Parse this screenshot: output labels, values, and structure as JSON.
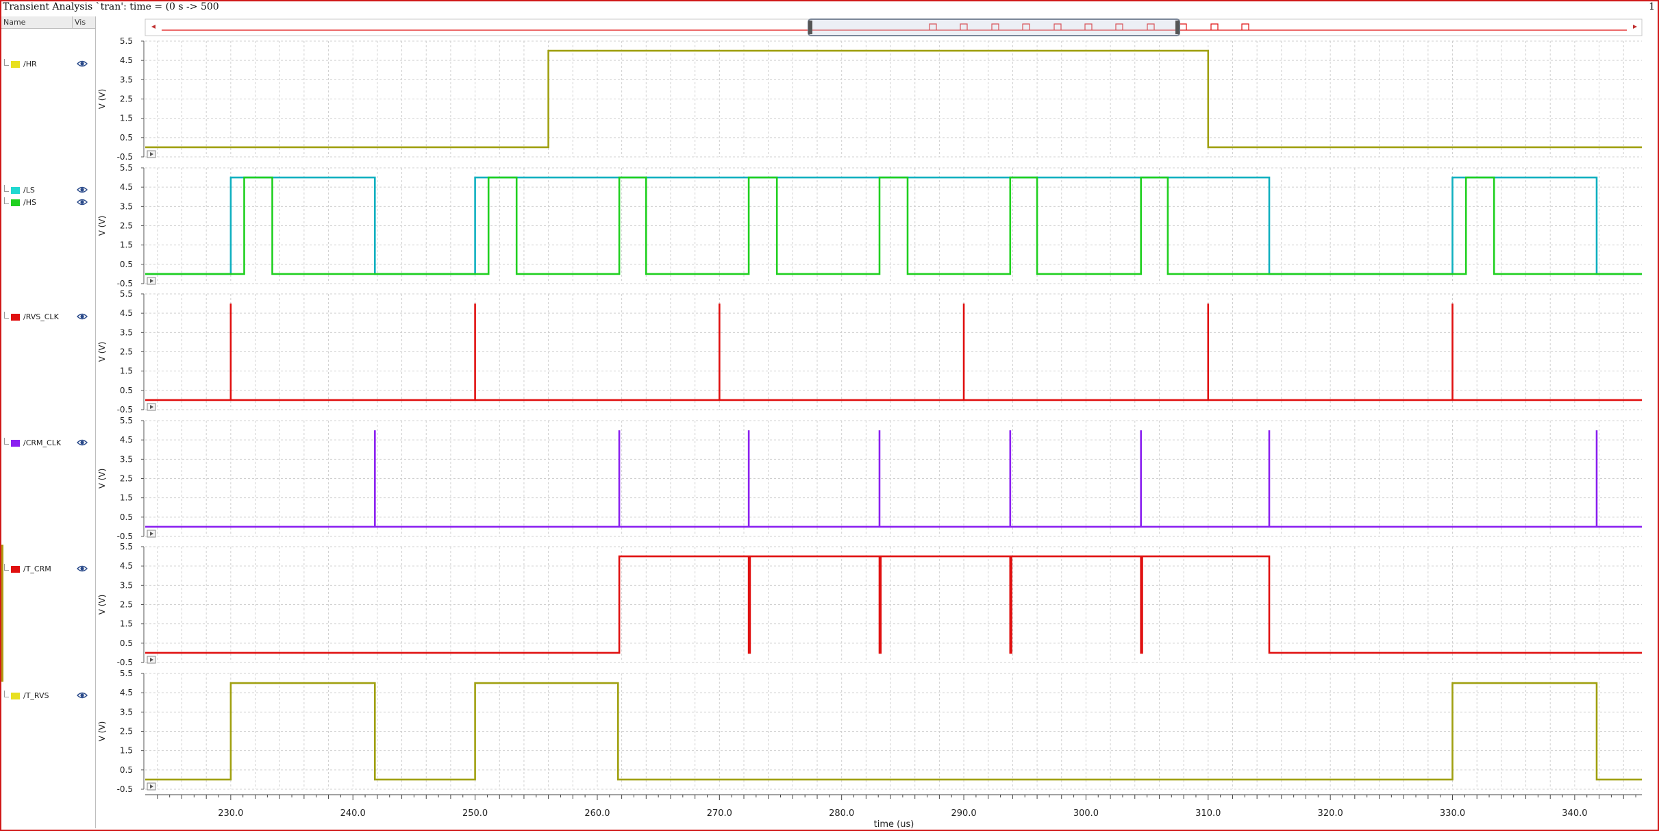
{
  "window": {
    "title": "Transient Analysis `tran': time = (0 s -> 500",
    "page_number": "1"
  },
  "sidebar": {
    "header_name": "Name",
    "header_vis": "Vis",
    "signals": [
      {
        "label": "/HR",
        "color": "#e8e020",
        "icon": "eye-icon"
      },
      {
        "label": "/LS",
        "color": "#20d8d0",
        "icon": "eye-icon"
      },
      {
        "label": "/HS",
        "color": "#20d020",
        "icon": "eye-icon"
      },
      {
        "label": "/RVS_CLK",
        "color": "#e01010",
        "icon": "eye-icon"
      },
      {
        "label": "/CRM_CLK",
        "color": "#8a20f0",
        "icon": "eye-icon"
      },
      {
        "label": "/T_CRM",
        "color": "#e01010",
        "icon": "eye-icon"
      },
      {
        "label": "/T_RVS",
        "color": "#e8e020",
        "icon": "eye-icon"
      }
    ]
  },
  "chart_data": {
    "type": "line",
    "xlabel": "time (us)",
    "xlim": [
      223.0,
      345.5
    ],
    "x_ticks": [
      "230.0",
      "240.0",
      "250.0",
      "260.0",
      "270.0",
      "280.0",
      "290.0",
      "300.0",
      "310.0",
      "320.0",
      "330.0",
      "340.0"
    ],
    "ylabel": "V (V)",
    "ylim": [
      -0.5,
      5.5
    ],
    "y_ticks": [
      "5.5",
      "4.5",
      "3.5",
      "2.5",
      "1.5",
      "0.5",
      "-0.5"
    ],
    "grid": true,
    "panels": [
      {
        "series": [
          {
            "name": "/HR",
            "color": "#a0a010",
            "low": 0.0,
            "high": 5.0,
            "x": [
              223.0,
              256.0,
              256.0,
              310.0,
              310.0,
              345.5
            ],
            "y": [
              0,
              0,
              5,
              5,
              0,
              0
            ]
          }
        ]
      },
      {
        "series": [
          {
            "name": "/LS",
            "color": "#10b0c0",
            "low": 0.0,
            "high": 5.0,
            "x": [
              223.0,
              230.0,
              230.0,
              241.8,
              241.8,
              250.0,
              250.0,
              315.0,
              315.0,
              330.0,
              330.0,
              341.8,
              341.8,
              345.5
            ],
            "y": [
              0,
              0,
              5,
              5,
              0,
              0,
              5,
              5,
              0,
              0,
              5,
              5,
              0,
              0
            ]
          },
          {
            "name": "/HS",
            "color": "#20d020",
            "low": 0.0,
            "high": 5.0,
            "x": [
              223.0,
              231.1,
              231.1,
              233.4,
              233.4,
              251.1,
              251.1,
              253.4,
              253.4,
              261.8,
              261.8,
              264.0,
              264.0,
              272.4,
              272.4,
              274.7,
              274.7,
              283.1,
              283.1,
              285.4,
              285.4,
              293.8,
              293.8,
              296.0,
              296.0,
              304.5,
              304.5,
              306.7,
              306.7,
              331.1,
              331.1,
              333.4,
              333.4,
              345.5
            ],
            "y": [
              0,
              0,
              5,
              5,
              0,
              0,
              5,
              5,
              0,
              0,
              5,
              5,
              0,
              0,
              5,
              5,
              0,
              0,
              5,
              5,
              0,
              0,
              5,
              5,
              0,
              0,
              5,
              5,
              0,
              0,
              5,
              5,
              0,
              0
            ]
          }
        ]
      },
      {
        "series": [
          {
            "name": "/RVS_CLK",
            "color": "#e01010",
            "low": 0.0,
            "high": 5.0,
            "pulses": [
              230.0,
              250.0,
              270.0,
              290.0,
              310.0,
              330.0
            ]
          }
        ]
      },
      {
        "series": [
          {
            "name": "/CRM_CLK",
            "color": "#8a20f0",
            "low": 0.0,
            "high": 5.0,
            "pulses": [
              241.8,
              261.8,
              272.4,
              283.1,
              293.8,
              304.5,
              315.0,
              341.8
            ]
          }
        ]
      },
      {
        "series": [
          {
            "name": "/T_CRM",
            "color": "#e01010",
            "low": 0.0,
            "high": 5.0,
            "x": [
              223.0,
              261.8,
              261.8,
              272.4,
              272.4,
              272.5,
              272.5,
              283.1,
              283.1,
              283.2,
              283.2,
              293.8,
              293.8,
              293.9,
              293.9,
              304.5,
              304.5,
              304.6,
              304.6,
              315.0,
              315.0,
              345.5
            ],
            "y": [
              0,
              0,
              5,
              5,
              0,
              0,
              5,
              5,
              0,
              0,
              5,
              5,
              0,
              0,
              5,
              5,
              0,
              0,
              5,
              5,
              0,
              0
            ]
          }
        ]
      },
      {
        "series": [
          {
            "name": "/T_RVS",
            "color": "#a0a010",
            "low": 0.0,
            "high": 5.0,
            "x": [
              223.0,
              230.0,
              230.0,
              241.8,
              241.8,
              250.0,
              250.0,
              261.7,
              261.7,
              330.0,
              330.0,
              341.8,
              341.8,
              345.5
            ],
            "y": [
              0,
              0,
              5,
              5,
              0,
              0,
              5,
              5,
              0,
              0,
              5,
              5,
              0,
              0
            ]
          }
        ]
      }
    ]
  },
  "colors": {
    "frame": "#d01818",
    "grid": "#d0d0d0",
    "overview_trace": "#e01010"
  }
}
